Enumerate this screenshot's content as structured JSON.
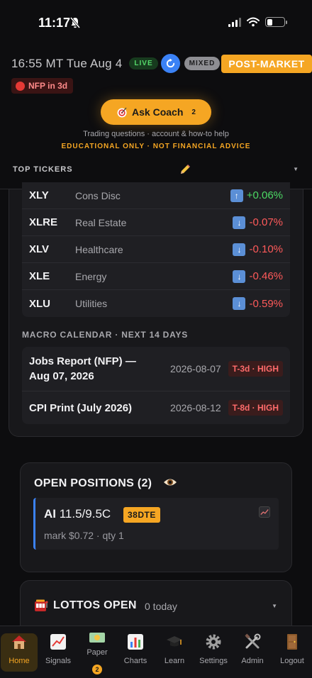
{
  "status_bar": {
    "time": "11:17"
  },
  "header": {
    "clock": "16:55 MT Tue Aug 4",
    "live_label": "LIVE",
    "mixed_label": "MIXED",
    "session_label": "POST-MARKET",
    "nfp_label": "NFP in 3d",
    "coach_label": "Ask Coach",
    "coach_count": "2",
    "help_text": "Trading questions · account & how-to help",
    "disclaimer": "EDUCATIONAL ONLY · NOT FINANCIAL ADVICE",
    "top_tickers_label": "TOP TICKERS"
  },
  "sectors": [
    {
      "symbol": "XLY",
      "name": "Cons Disc",
      "change": "+0.06%",
      "direction": "up"
    },
    {
      "symbol": "XLRE",
      "name": "Real Estate",
      "change": "-0.07%",
      "direction": "down"
    },
    {
      "symbol": "XLV",
      "name": "Healthcare",
      "change": "-0.10%",
      "direction": "down"
    },
    {
      "symbol": "XLE",
      "name": "Energy",
      "change": "-0.46%",
      "direction": "down"
    },
    {
      "symbol": "XLU",
      "name": "Utilities",
      "change": "-0.59%",
      "direction": "down"
    }
  ],
  "macro": {
    "title": "MACRO CALENDAR · NEXT 14 DAYS",
    "events": [
      {
        "name": "Jobs Report (NFP) — Aug 07, 2026",
        "date": "2026-08-07",
        "impact": "T-3d · HIGH"
      },
      {
        "name": "CPI Print (July 2026)",
        "date": "2026-08-12",
        "impact": "T-8d · HIGH"
      }
    ]
  },
  "positions": {
    "title": "OPEN POSITIONS (2)",
    "items": [
      {
        "ticker": "AI",
        "contract": "11.5/9.5C",
        "dte": "38DTE",
        "detail": "mark $0.72 · qty 1"
      }
    ]
  },
  "lottos": {
    "title": "LOTTOS OPEN",
    "count": "0 today"
  },
  "tabs": [
    {
      "label": "Home",
      "icon": "house-icon"
    },
    {
      "label": "Signals",
      "icon": "chart-up-icon"
    },
    {
      "label": "Paper",
      "icon": "money-icon",
      "badge": "2"
    },
    {
      "label": "Charts",
      "icon": "bar-chart-icon"
    },
    {
      "label": "Learn",
      "icon": "graduation-cap-icon"
    },
    {
      "label": "Settings",
      "icon": "gear-icon"
    },
    {
      "label": "Admin",
      "icon": "tools-icon"
    },
    {
      "label": "Logout",
      "icon": "door-icon"
    }
  ],
  "colors": {
    "accent": "#f5a623",
    "up": "#4cd964",
    "down": "#ff5a5a",
    "live": "#55d86a",
    "info": "#3b82f6"
  }
}
